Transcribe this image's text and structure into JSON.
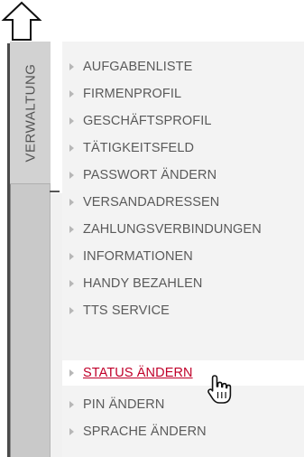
{
  "sidebar": {
    "tab_label": "VERWALTUNG"
  },
  "menu": {
    "items": [
      {
        "label": "AUFGABENLISTE",
        "active": false
      },
      {
        "label": "FIRMENPROFIL",
        "active": false
      },
      {
        "label": "GESCHÄFTSPROFIL",
        "active": false
      },
      {
        "label": "TÄTIGKEITSFELD",
        "active": false
      },
      {
        "label": "PASSWORT ÄNDERN",
        "active": false
      },
      {
        "label": "VERSANDADRESSEN",
        "active": false
      },
      {
        "label": "ZAHLUNGSVERBINDUNGEN",
        "active": false
      },
      {
        "label": "INFORMATIONEN",
        "active": false
      },
      {
        "label": "HANDY BEZAHLEN",
        "active": false
      },
      {
        "label": "TTS SERVICE",
        "active": false
      },
      {
        "label": "STATUS ÄNDERN",
        "active": true
      },
      {
        "label": "PIN ÄNDERN",
        "active": false
      },
      {
        "label": "SPRACHE ÄNDERN",
        "active": false
      }
    ]
  },
  "colors": {
    "active_text": "#c0002a",
    "menu_text": "#5a5a5a",
    "menu_bg": "#f3f3f3",
    "tab_bg": "#c9c9c9"
  },
  "icons": {
    "top": "up-arrow-icon",
    "bullet": "triangle-bullet-icon",
    "cursor": "hand-pointer-icon"
  }
}
